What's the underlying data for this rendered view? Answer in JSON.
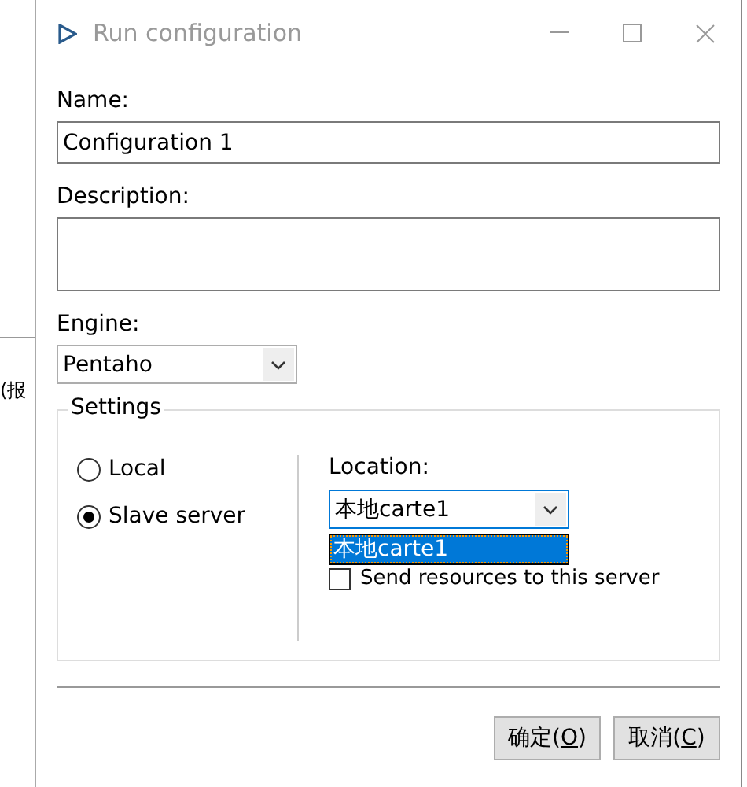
{
  "background_window": {
    "text": "(报"
  },
  "window": {
    "title": "Run configuration"
  },
  "name": {
    "label": "Name:",
    "value": "Configuration 1"
  },
  "description": {
    "label": "Description:"
  },
  "engine": {
    "label": "Engine:",
    "value": "Pentaho"
  },
  "settings": {
    "title": "Settings",
    "modes": [
      {
        "label": "Local",
        "selected": false
      },
      {
        "label": "Slave server",
        "selected": true
      }
    ],
    "location": {
      "label": "Location:",
      "value": "本地carte1",
      "expanded": true,
      "options": [
        {
          "label": "本地carte1",
          "selected": true
        }
      ]
    },
    "send_resources": {
      "label": "Send resources to this server",
      "checked": false
    }
  },
  "buttons": [
    {
      "before": "确定(",
      "key": "O",
      "after": ")"
    },
    {
      "before": "取消(",
      "key": "C",
      "after": ")"
    }
  ]
}
